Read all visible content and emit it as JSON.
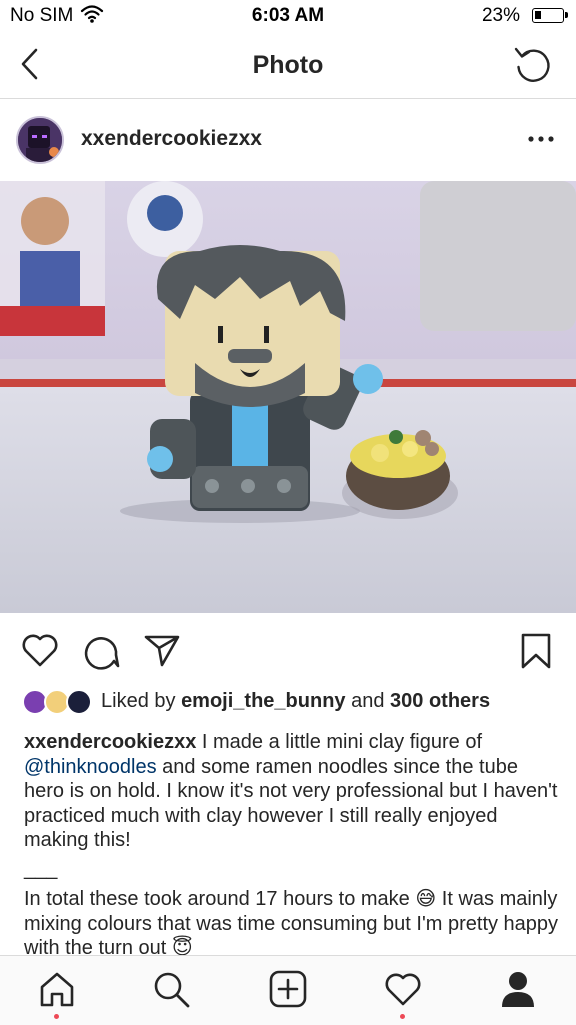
{
  "status_bar": {
    "carrier": "No SIM",
    "time": "6:03 AM",
    "battery": "23%"
  },
  "nav": {
    "title": "Photo",
    "back_icon": "chevron-left-icon",
    "refresh_icon": "refresh-icon"
  },
  "post": {
    "username": "xxendercookiezxx",
    "more_icon": "more-horizontal-icon"
  },
  "actions": {
    "icons": [
      "heart-icon",
      "comment-icon",
      "share-icon",
      "bookmark-icon"
    ]
  },
  "likes": {
    "prefix": "Liked by ",
    "user": "emoji_the_bunny",
    "middle": " and ",
    "others": "300 others"
  },
  "caption": {
    "username": "xxendercookiezxx",
    "text_before_mention": " I made a little mini clay figure of ",
    "mention": "@thinknoodles",
    "text_after_mention": " and some ramen noodles since the tube hero is on hold. I know it's not very professional but I haven't practiced much with clay however I still really enjoyed making this!",
    "separator": "___",
    "paragraph2_part1": "In total these took around 17 hours to make ",
    "emoji1": "😅",
    "paragraph2_part2": " It was mainly mixing colours that was time consuming but I'm pretty happy with the turn out ",
    "emoji2": "😇"
  },
  "tab_bar": {
    "tabs": [
      "home-icon",
      "search-icon",
      "add-icon",
      "activity-heart-icon",
      "profile-icon"
    ],
    "notification_color": "#ed4956"
  },
  "colors": {
    "text": "#262626",
    "mention": "#003569",
    "divider": "#dbdbdb"
  }
}
